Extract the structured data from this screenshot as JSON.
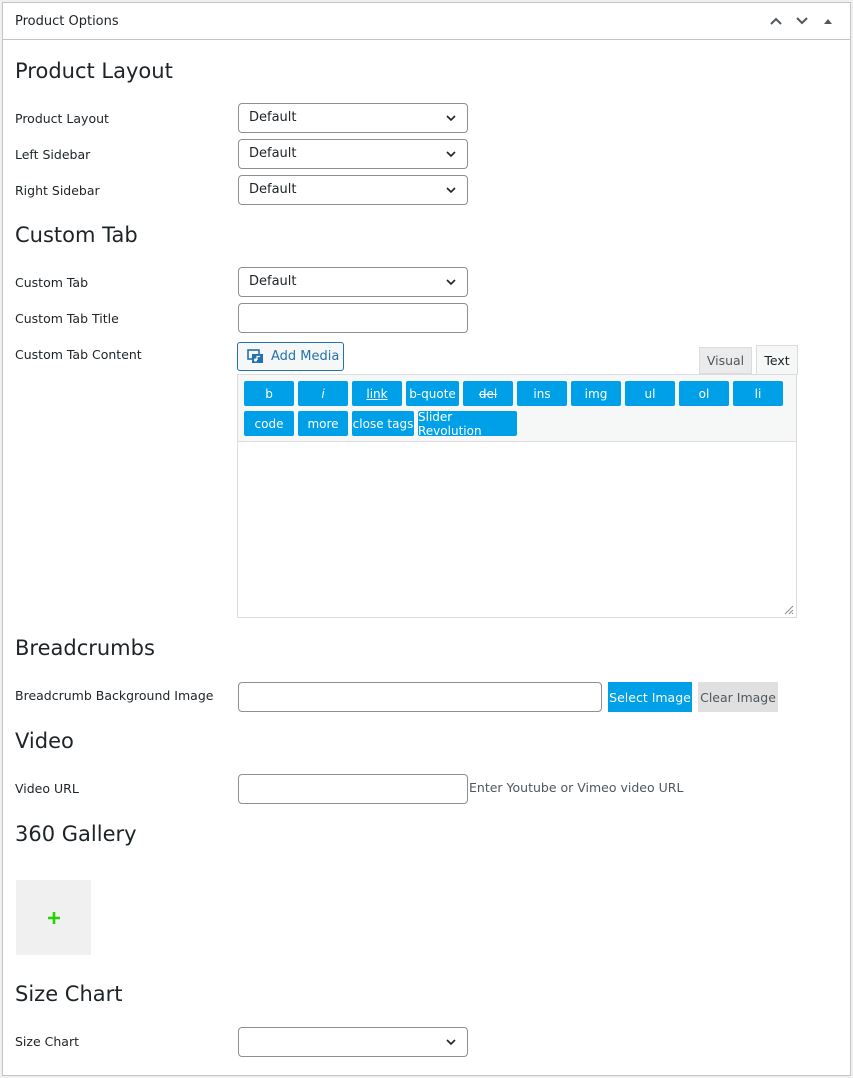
{
  "header": {
    "title": "Product Options"
  },
  "sections": {
    "product_layout": "Product Layout",
    "custom_tab": "Custom Tab",
    "breadcrumbs": "Breadcrumbs",
    "video": "Video",
    "gallery_360": "360 Gallery",
    "size_chart": "Size Chart"
  },
  "fields": {
    "product_layout": {
      "label": "Product Layout",
      "value": "Default"
    },
    "left_sidebar": {
      "label": "Left Sidebar",
      "value": "Default"
    },
    "right_sidebar": {
      "label": "Right Sidebar",
      "value": "Default"
    },
    "custom_tab": {
      "label": "Custom Tab",
      "value": "Default"
    },
    "custom_tab_title": {
      "label": "Custom Tab Title",
      "value": ""
    },
    "custom_tab_content": {
      "label": "Custom Tab Content"
    },
    "breadcrumb_bg": {
      "label": "Breadcrumb Background Image",
      "value": ""
    },
    "video_url": {
      "label": "Video URL",
      "value": "",
      "hint": "Enter Youtube or Vimeo video URL"
    },
    "size_chart": {
      "label": "Size Chart",
      "value": ""
    }
  },
  "editor": {
    "add_media": "Add Media",
    "tab_visual": "Visual",
    "tab_text": "Text",
    "quicktags": [
      "b",
      "i",
      "link",
      "b-quote",
      "del",
      "ins",
      "img",
      "ul",
      "ol",
      "li",
      "code",
      "more",
      "close tags",
      "Slider Revolution"
    ],
    "content": ""
  },
  "buttons": {
    "select_image": "Select Image",
    "clear_image": "Clear Image",
    "gallery_add": "+"
  },
  "colors": {
    "accent": "#00a0e9",
    "link_blue": "#2271b1",
    "gallery_plus": "#22d400"
  }
}
